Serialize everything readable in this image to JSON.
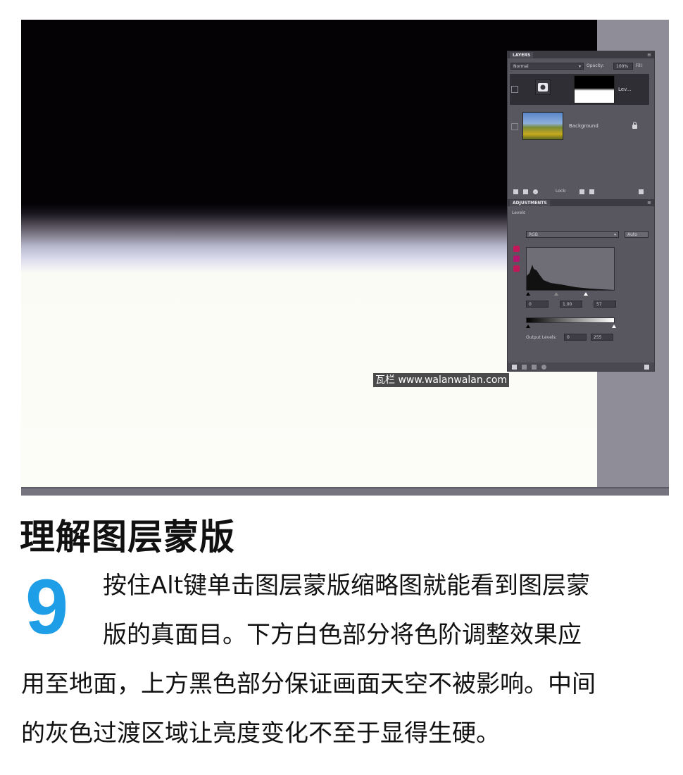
{
  "panel": {
    "layers_tab": "LAYERS",
    "blend_mode": "Normal",
    "opacity_label": "Opacity:",
    "opacity_value": "100%",
    "fill_label": "Fill:",
    "layers": [
      {
        "name": "Lev..."
      },
      {
        "name": "Background"
      }
    ],
    "lock_label": "Lock:",
    "adjustments_tab": "ADJUSTMENTS",
    "levels_title": "Levels",
    "channel": "RGB",
    "auto_label": "Auto",
    "input_values": [
      "0",
      "1.00",
      "57"
    ],
    "output_label": "Output Levels:",
    "output_values": [
      "0",
      "255"
    ]
  },
  "watermark": "瓦栏 www.walanwalan.com",
  "article": {
    "heading": "理解图层蒙版",
    "step_number": "9",
    "lines": [
      "按住Alt键单击图层蒙版缩略图就能看到图层蒙",
      "版的真面目。下方白色部分将色阶调整效果应",
      "用至地面，上方黑色部分保证画面天空不被影响。中间",
      "的灰色过渡区域让亮度变化不至于显得生硬。"
    ]
  },
  "colors": {
    "step_accent": "#1e9ee6",
    "panel_bg": "#58575f",
    "screen_gray": "#8f8e98"
  }
}
